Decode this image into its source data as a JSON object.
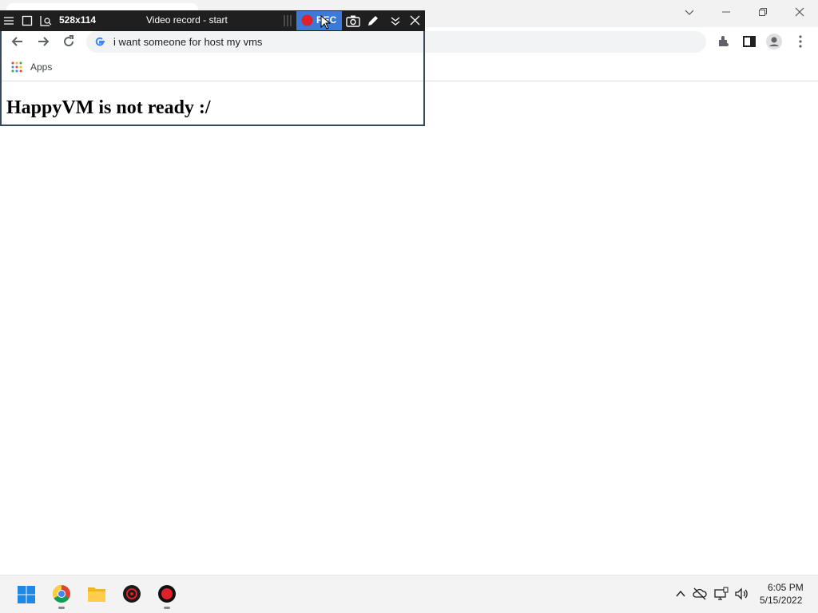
{
  "browser": {
    "address_bar_text": "i want someone for host my vms",
    "bookmarks": [
      {
        "label": "Apps"
      }
    ],
    "page_heading": "HappyVM is not ready :/"
  },
  "recorder": {
    "size_label": "528x114",
    "title": "Video record - start",
    "rec_label": "REC"
  },
  "taskbar": {
    "apps": [
      {
        "name": "windows-start-icon"
      },
      {
        "name": "chrome-icon"
      },
      {
        "name": "file-explorer-icon"
      },
      {
        "name": "red-app-icon"
      },
      {
        "name": "screen-recorder-icon"
      }
    ],
    "time": "6:05 PM",
    "date": "5/15/2022"
  },
  "colors": {
    "recorder_bar": "#1f1f1f",
    "rec_button": "#3b7ad6",
    "rec_dot": "#e0202a",
    "recorder_border": "#34495e"
  }
}
